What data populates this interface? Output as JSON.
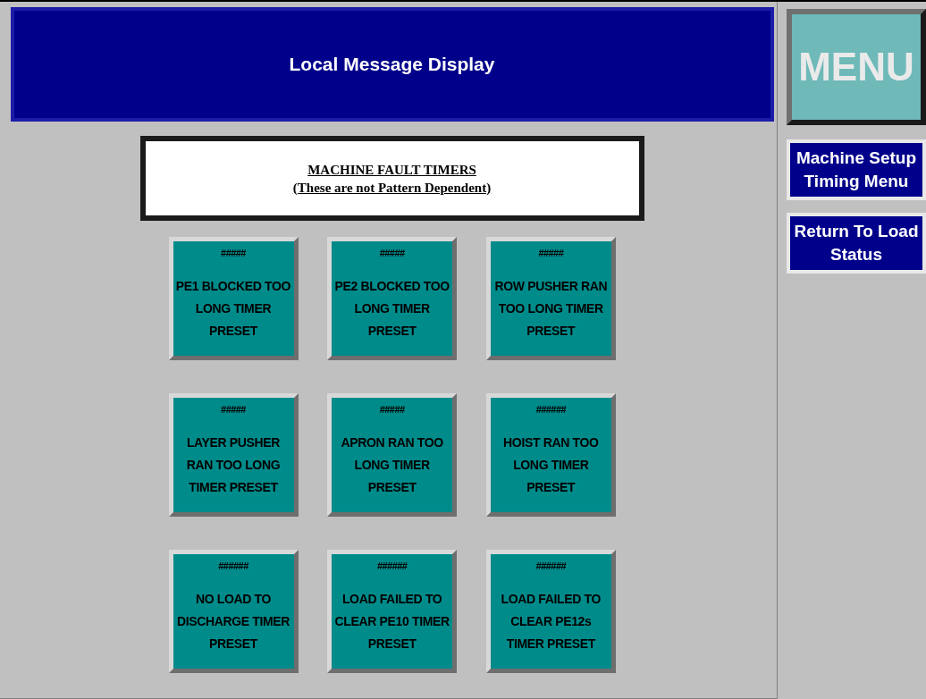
{
  "header": {
    "title": "Local Message Display"
  },
  "menu_button": {
    "label": "MENU"
  },
  "notice": {
    "title": "MACHINE FAULT TIMERS",
    "subtitle": "(These are not Pattern Dependent)"
  },
  "timers": [
    {
      "value": "#####",
      "label": "PE1 BLOCKED TOO LONG TIMER PRESET"
    },
    {
      "value": "#####",
      "label": "PE2 BLOCKED TOO LONG TIMER PRESET"
    },
    {
      "value": "#####",
      "label": "ROW PUSHER RAN TOO LONG TIMER PRESET"
    },
    {
      "value": "#####",
      "label": "LAYER PUSHER RAN TOO LONG TIMER PRESET"
    },
    {
      "value": "#####",
      "label": "APRON RAN TOO LONG TIMER PRESET"
    },
    {
      "value": "######",
      "label": "HOIST RAN TOO LONG TIMER PRESET"
    },
    {
      "value": "######",
      "label": "NO LOAD TO DISCHARGE TIMER PRESET"
    },
    {
      "value": "######",
      "label": "LOAD FAILED TO CLEAR PE10 TIMER PRESET"
    },
    {
      "value": "######",
      "label": "LOAD FAILED TO CLEAR PE12s TIMER PRESET"
    }
  ],
  "nav_buttons": [
    {
      "label": "Machine Setup Timing Menu"
    },
    {
      "label": "Return To Load Status"
    }
  ]
}
